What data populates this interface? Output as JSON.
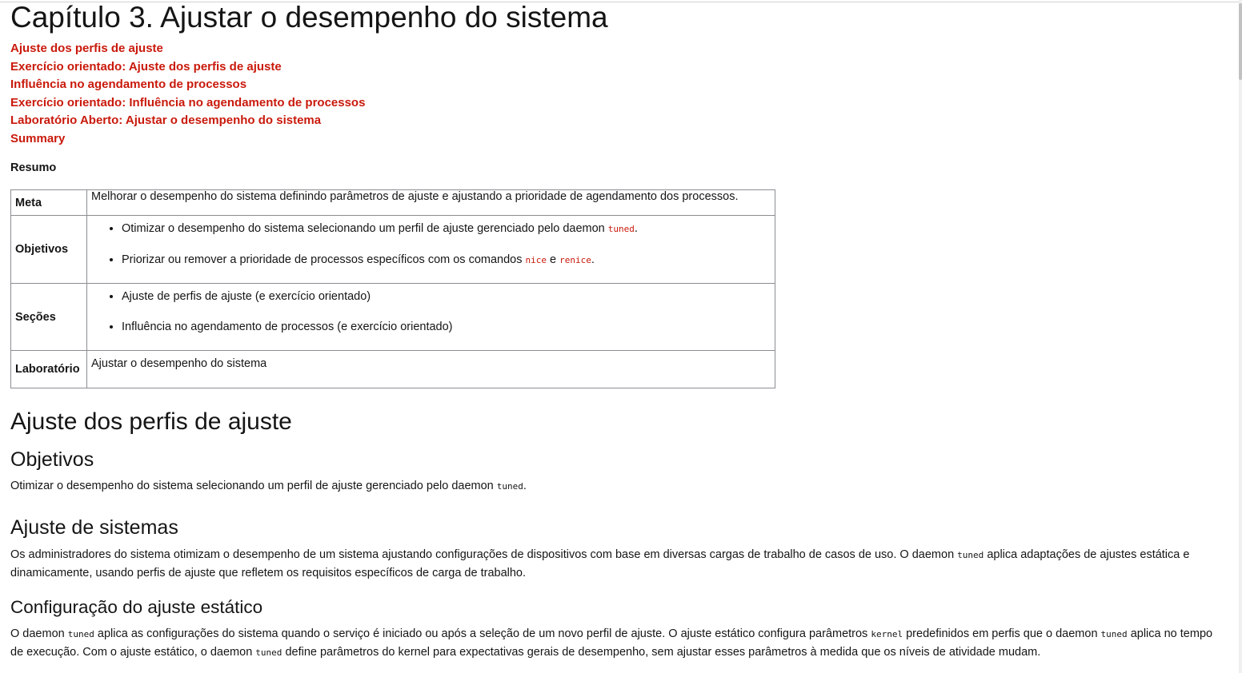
{
  "chapter_title": "Capítulo 3. Ajustar o desempenho do sistema",
  "toc": [
    "Ajuste dos perfis de ajuste",
    "Exercício orientado: Ajuste dos perfis de ajuste",
    "Influência no agendamento de processos",
    "Exercício orientado: Influência no agendamento de processos",
    "Laboratório Aberto: Ajustar o desempenho do sistema",
    "Summary"
  ],
  "summary_heading": "Resumo",
  "summary_table": {
    "meta_label": "Meta",
    "meta_value": "Melhorar o desempenho do sistema definindo parâmetros de ajuste e ajustando a prioridade de agendamento dos processos.",
    "objectives_label": "Objetivos",
    "objective_1_text": "Otimizar o desempenho do sistema selecionando um perfil de ajuste gerenciado pelo daemon ",
    "objective_1_code": "tuned",
    "objective_2_text": "Priorizar ou remover a prioridade de processos específicos com os comandos ",
    "objective_2_code_a": "nice",
    "objective_2_join": " e ",
    "objective_2_code_b": "renice",
    "period": ".",
    "sections_label": "Seções",
    "sections": [
      "Ajuste de perfis de ajuste (e exercício orientado)",
      "Influência no agendamento de processos (e exercício orientado)"
    ],
    "lab_label": "Laboratório",
    "lab_value": "Ajustar o desempenho do sistema"
  },
  "section_title": "Ajuste dos perfis de ajuste",
  "objectives_heading": "Objetivos",
  "objectives_paragraph": {
    "text": "Otimizar o desempenho do sistema selecionando um perfil de ajuste gerenciado pelo daemon ",
    "code": "tuned",
    "end": "."
  },
  "tuning_heading": "Ajuste de sistemas",
  "tuning_paragraph": {
    "part1": "Os administradores do sistema otimizam o desempenho de um sistema ajustando configurações de dispositivos com base em diversas cargas de trabalho de casos de uso. O daemon ",
    "code1": "tuned",
    "part2": " aplica adaptações de ajustes estática e dinamicamente, usando perfis de ajuste que refletem os requisitos específicos de carga de trabalho."
  },
  "static_heading": "Configuração do ajuste estático",
  "static_paragraph": {
    "part1": "O daemon ",
    "code1": "tuned",
    "part2": " aplica as configurações do sistema quando o serviço é iniciado ou após a seleção de um novo perfil de ajuste. O ajuste estático configura parâmetros ",
    "code2": "kernel",
    "part3": " predefinidos em perfis que o daemon ",
    "code3": "tuned",
    "part4": " aplica no tempo de execução. Com o ajuste estático, o daemon ",
    "code4": "tuned",
    "part5": " define parâmetros do kernel para expectativas gerais de desempenho, sem ajustar esses parâmetros à medida que os níveis de atividade mudam."
  }
}
